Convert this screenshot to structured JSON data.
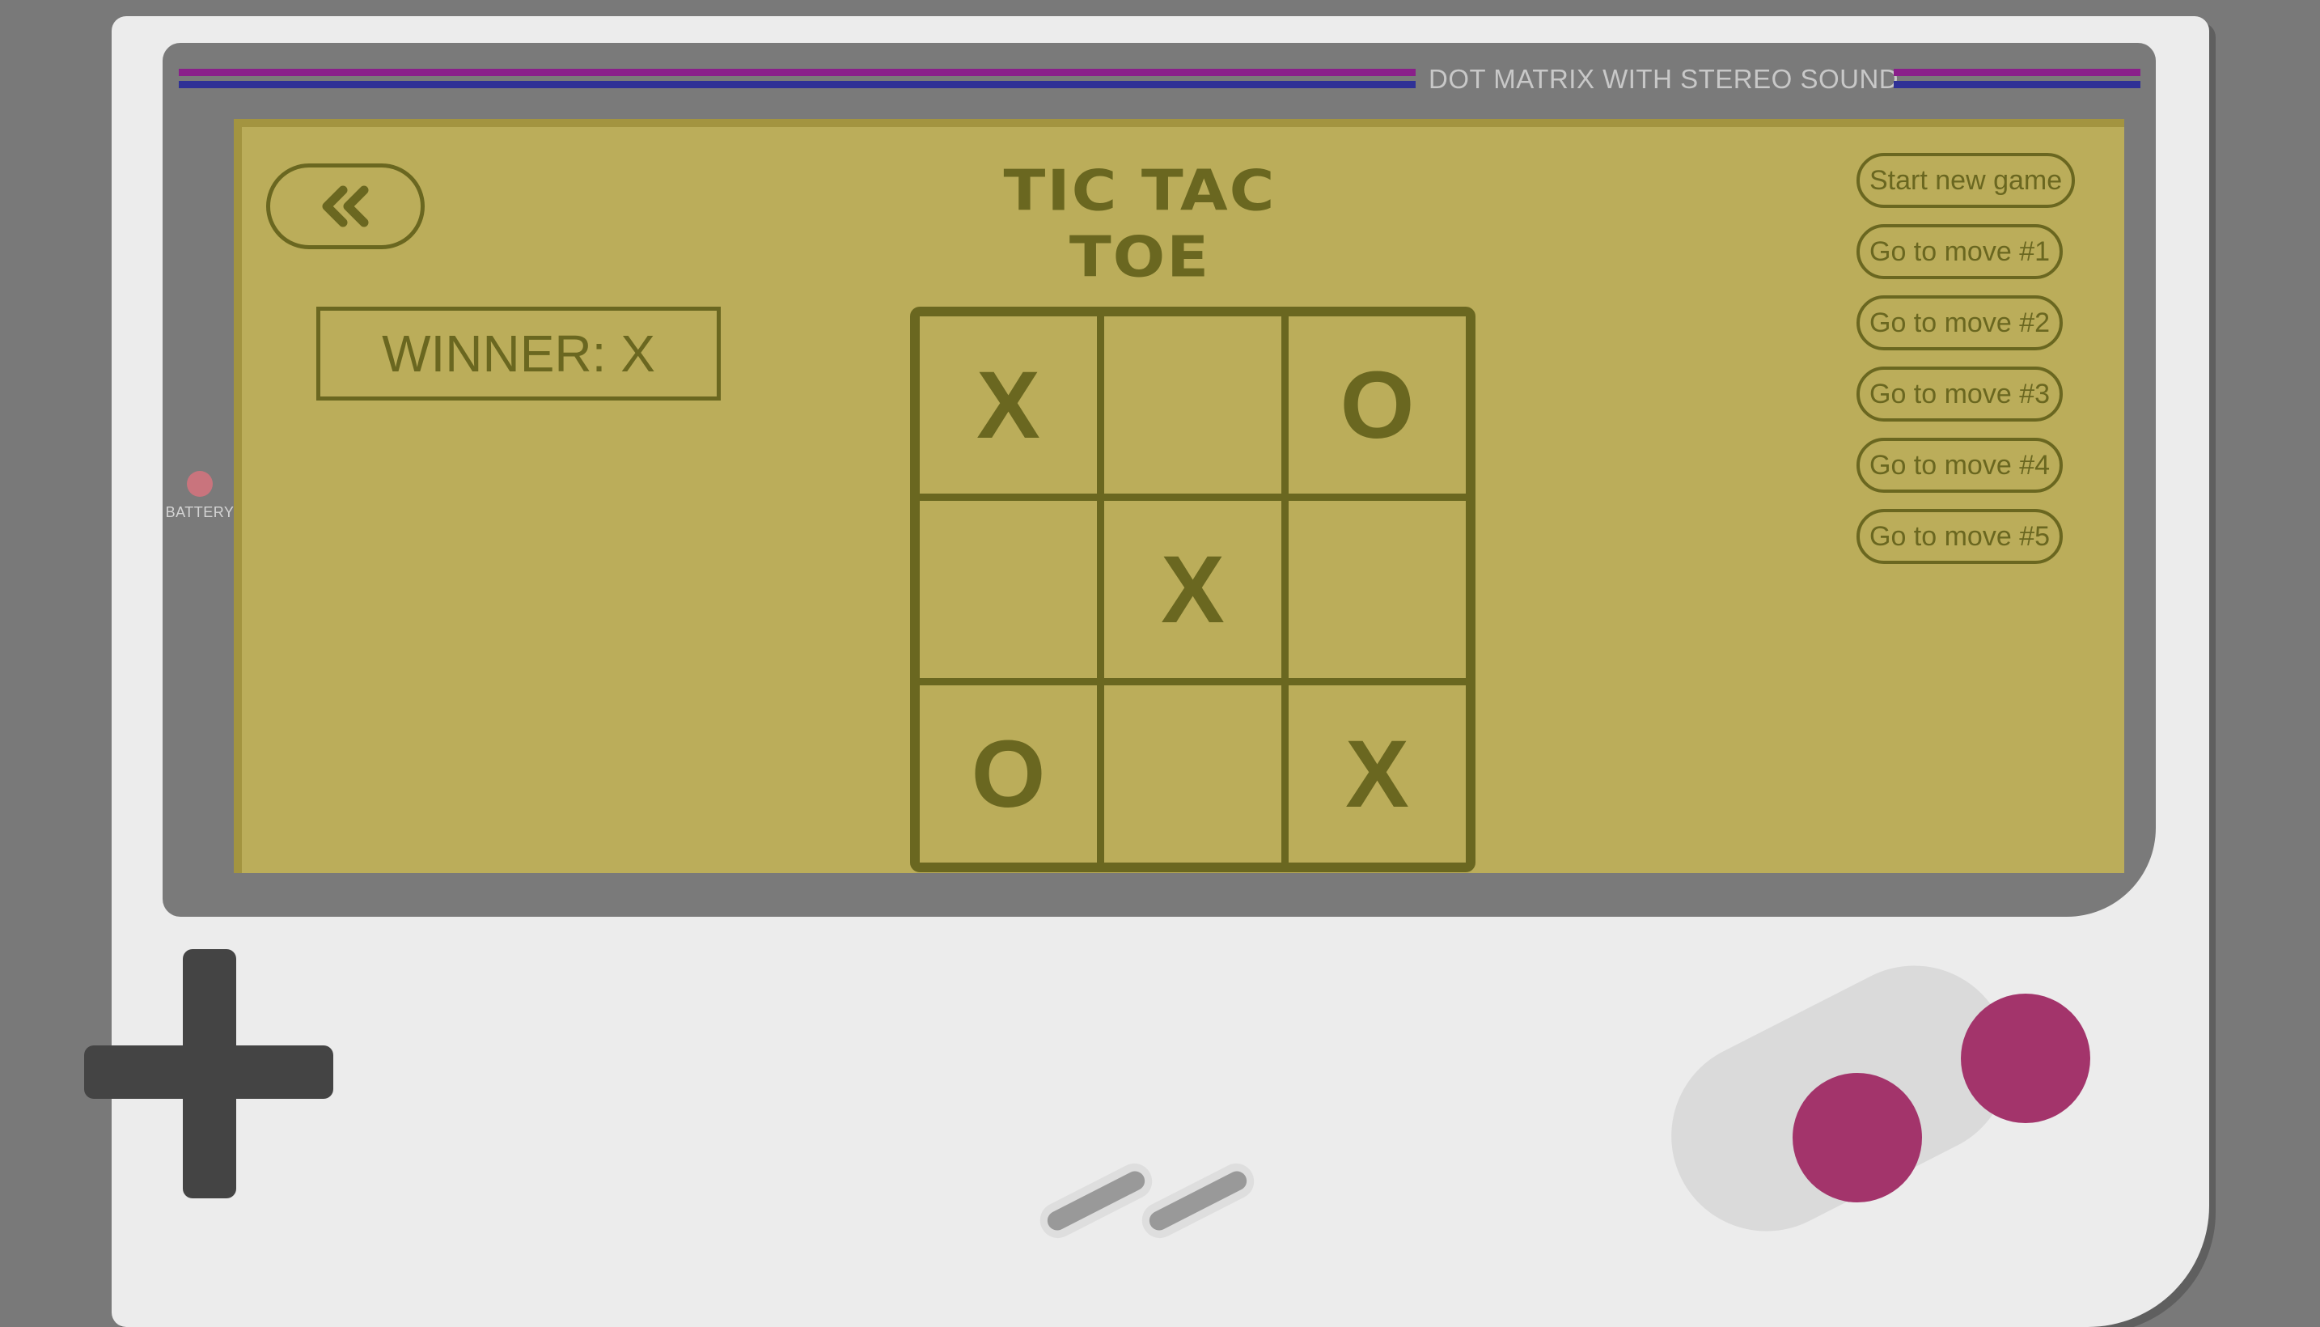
{
  "device": {
    "bezel_title": "DOT MATRIX WITH STEREO SOUND",
    "battery_label": "BATTERY"
  },
  "game": {
    "title": "TIC TAC TOE",
    "winner_text": "WINNER: X",
    "back_icon": "double-chevron-left-icon",
    "board": [
      [
        "X",
        "",
        "O"
      ],
      [
        "",
        "X",
        ""
      ],
      [
        "O",
        "",
        "X"
      ]
    ]
  },
  "history": {
    "items": [
      "Start new game",
      "Go to move #1",
      "Go to move #2",
      "Go to move #3",
      "Go to move #4",
      "Go to move #5"
    ]
  },
  "colors": {
    "screen": "#bbad5a",
    "ink": "#6a6720",
    "stripe_purple": "#8a1f8a",
    "stripe_blue": "#2f3196",
    "ab_buttons": "#a3346b",
    "dpad": "#444444"
  }
}
